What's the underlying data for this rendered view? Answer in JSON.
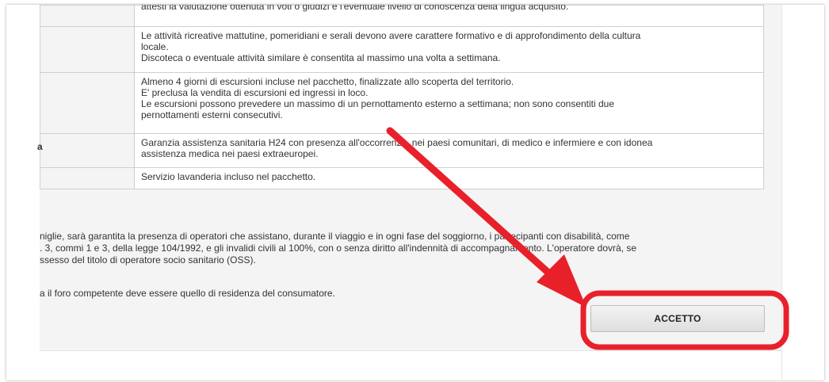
{
  "table": {
    "rows": [
      {
        "label": "",
        "lines": [
          "attesti la valutazione ottenuta in voti o giudizi e l'eventuale livello di conoscenza della lingua acquisito."
        ]
      },
      {
        "label": "",
        "lines": [
          "Le attività ricreative mattutine, pomeridiani e serali devono avere carattere formativo e di approfondimento della cultura",
          "locale.",
          "Discoteca o eventuale attività similare è consentita al massimo una volta a settimana."
        ]
      },
      {
        "label": "",
        "lines": [
          "Almeno 4 giorni di escursioni incluse nel pacchetto, finalizzate allo scoperta del territorio.",
          "E' preclusa la vendita di escursioni ed ingressi in loco.",
          "Le escursioni possono prevedere un massimo di un pernottamento esterno a settimana; non sono consentiti due",
          "pernottamenti esterni consecutivi."
        ]
      },
      {
        "label": "a",
        "lines": [
          "Garanzia assistenza sanitaria H24 con presenza all'occorrenza, nei paesi comunitari, di medico e infermiere e con idonea",
          "assistenza medica nei paesi extraeuropei."
        ]
      },
      {
        "label": "",
        "lines": [
          "Servizio lavanderia incluso nel pacchetto."
        ]
      }
    ]
  },
  "notes": {
    "disability_lines": [
      "niglie, sarà garantita la presenza di operatori che assistano, durante il viaggio e in ogni fase del soggiorno, i partecipanti con disabilità, come",
      ". 3, commi 1 e 3, della legge 104/1992, e gli invalidi civili al 100%, con o senza diritto all'indennità di accompagnamento. L'operatore dovrà, se",
      "ssesso del titolo di operatore socio sanitario (OSS)."
    ],
    "jurisdiction": "a il foro competente deve essere quello di residenza del consumatore."
  },
  "accept_button": {
    "label": "ACCETTO"
  },
  "annotation": {
    "color": "#e8202a"
  }
}
